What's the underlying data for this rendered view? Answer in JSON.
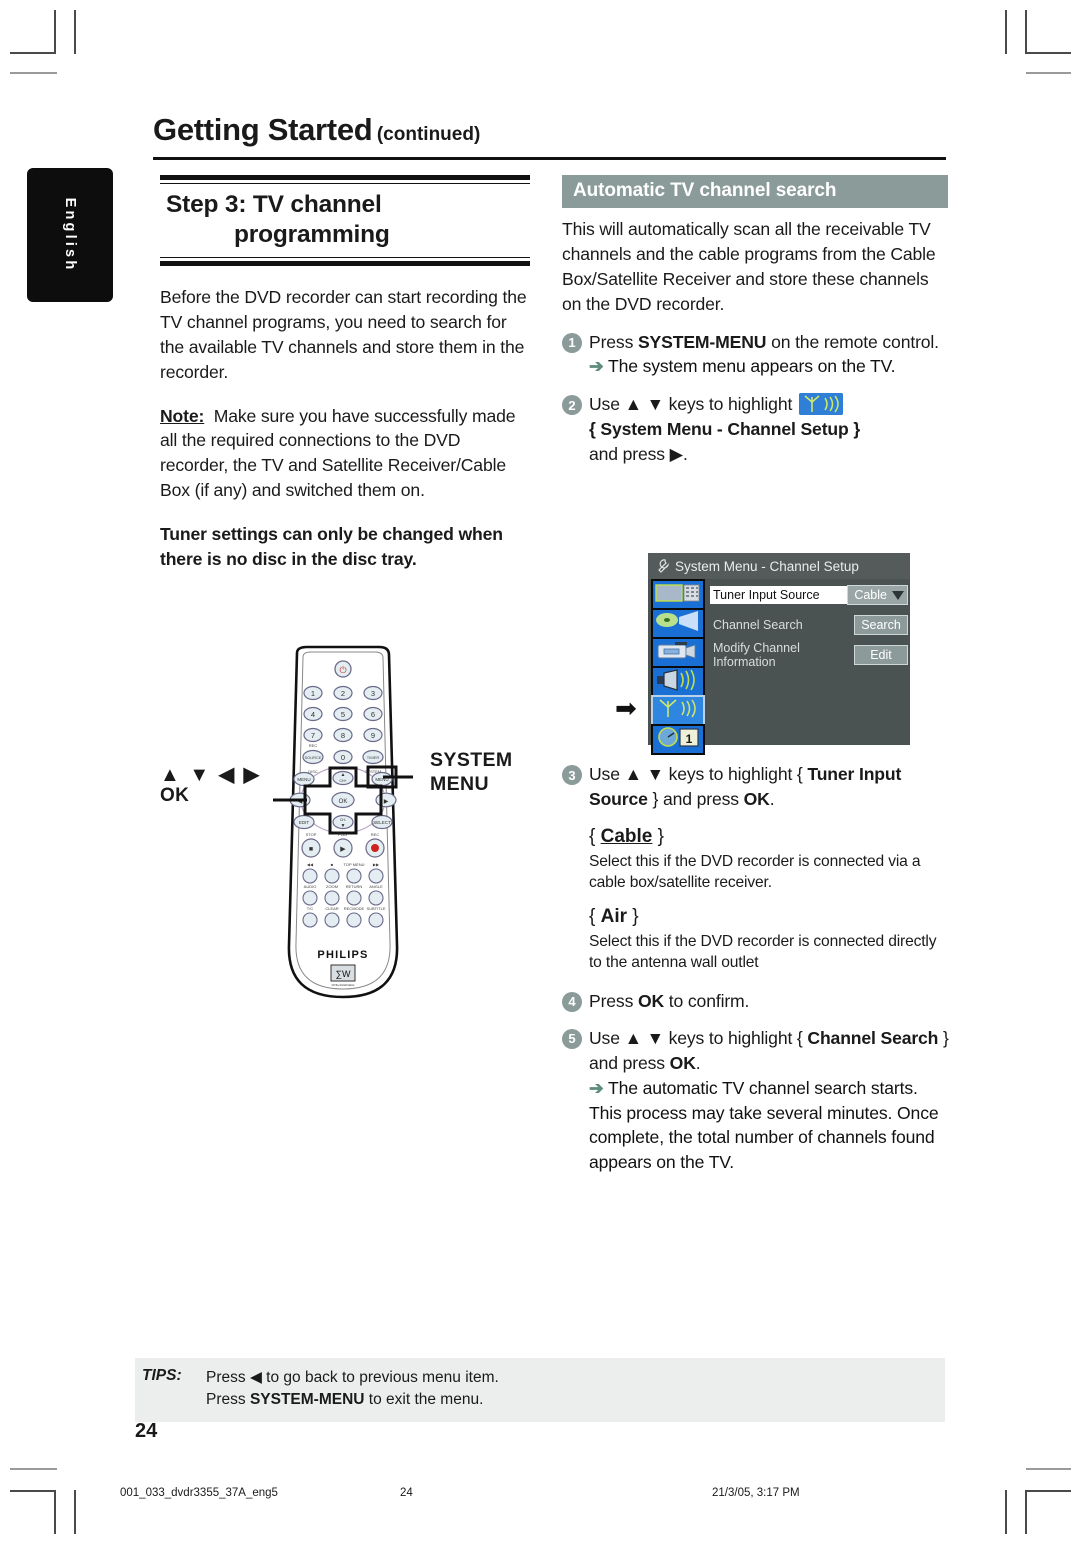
{
  "language_tab": "English",
  "running_head": {
    "title": "Getting Started",
    "suffix": "(continued)"
  },
  "left_column": {
    "step_heading_line1": "Step 3: TV channel",
    "step_heading_line2": "programming",
    "intro": "Before the DVD recorder can start recording the TV channel programs, you need to search for the available TV channels and store them in the recorder.",
    "note_label": "Note:",
    "note_text": "Make sure you have successfully made all the required connections to the DVD recorder, the TV and Satellite Receiver/Cable Box (if any) and switched them on.",
    "warning": "Tuner settings can only be changed when there is no disc in the disc tray.",
    "remote_labels": {
      "system_menu": "SYSTEM MENU",
      "system_menu_line1": "SYSTEM",
      "system_menu_line2": "MENU",
      "navigation_keys": "▲ ▼ ◀ ▶",
      "ok": "OK"
    },
    "remote_brand": "PHILIPS",
    "remote_buttons": {
      "power": "⏻",
      "numbers": [
        "1",
        "2",
        "3",
        "4",
        "5",
        "6",
        "7",
        "8",
        "9",
        "0"
      ],
      "rec_source": "REC SOURCE",
      "timer": "TIMER",
      "disc_menu": "DISC MENU",
      "system_menu": "SYSTEM MENU",
      "edit": "EDIT",
      "select": "SELECT",
      "ok": "OK",
      "stop": "STOP",
      "play": "PLAY",
      "rec": "REC",
      "row1": [
        "◀◀",
        "■",
        "TOP MENU",
        "▶▶"
      ],
      "row2": [
        "AUDIO",
        "ZOOM",
        "RETURN",
        "ANGLE"
      ],
      "row3": [
        "T/C",
        "CLEAR",
        "REC MODE",
        "SUBTITLE"
      ]
    }
  },
  "right_column": {
    "section_title": "Automatic TV channel search",
    "intro": "This will automatically scan all the receivable TV channels and the cable programs from the Cable Box/Satellite Receiver and store these channels on the DVD recorder.",
    "steps": [
      {
        "num": "1",
        "text_parts": [
          "Press ",
          "SYSTEM-MENU",
          " on the remote control."
        ],
        "result": "The system menu appears on the TV."
      },
      {
        "num": "2",
        "pre": "Use ▲ ▼ keys to highlight",
        "icon": "antenna-icon",
        "bold_line": "{ System Menu - Channel Setup }",
        "post": "and press ▶."
      },
      {
        "num": "3",
        "pre": "Use ▲ ▼ keys to highlight {",
        "bold": "Tuner Input Source",
        "post": "} and press",
        "bold2": "OK",
        "tail": "."
      },
      {
        "num": "4",
        "text": "Press ",
        "bold": "OK",
        "tail": " to confirm."
      },
      {
        "num": "5",
        "pre": "Use ▲ ▼ keys to highlight {",
        "bold": "Channel Search",
        "post": "} and press",
        "bold2": "OK",
        "tail": ".",
        "result": "The automatic TV channel search starts. This process may take several minutes. Once complete, the total number of channels found appears on the TV."
      }
    ],
    "options": [
      {
        "label": "{ Cable }",
        "name": "Cable",
        "desc": "Select this if the DVD recorder is connected via a cable box/satellite receiver."
      },
      {
        "label": "{ Air }",
        "name": "Air",
        "desc": "Select this if the DVD recorder is connected directly to the antenna wall outlet"
      }
    ]
  },
  "tv_menu": {
    "title": "System Menu - Channel Setup",
    "rows": [
      {
        "label": "Tuner Input Source",
        "control": "Cable",
        "type": "dropdown",
        "active": true
      },
      {
        "label": "Channel Search",
        "control": "Search",
        "type": "button",
        "active": false
      },
      {
        "label": "Modify Channel Information",
        "control": "Edit",
        "type": "button",
        "active": false
      }
    ],
    "icons": [
      "tv-recorder-icon",
      "playback-icon",
      "camcorder-icon",
      "speaker-audio-icon",
      "antenna-channel-icon",
      "clock-timer-icon"
    ],
    "selected_icon_index": 4,
    "pointer": "➡"
  },
  "tips": {
    "label": "TIPS:",
    "line1_pre": "Press ",
    "line1_icon": "◀",
    "line1_post": " to go back to previous menu item.",
    "line2_pre": "Press ",
    "line2_bold": "SYSTEM-MENU",
    "line2_post": " to exit the menu."
  },
  "page_number": "24",
  "print_footer": {
    "filename": "001_033_dvdr3355_37A_eng5",
    "page": "24",
    "datetime": "21/3/05, 3:17 PM"
  },
  "colors": {
    "accent_bar": "#8a9b99",
    "tips_bg": "#eceeee",
    "tv_menu_bg": "#4a5252",
    "tv_title_bg": "#555b5b",
    "icon_blue": "#1a6fd4",
    "arrow_green": "#5e8c7e"
  }
}
